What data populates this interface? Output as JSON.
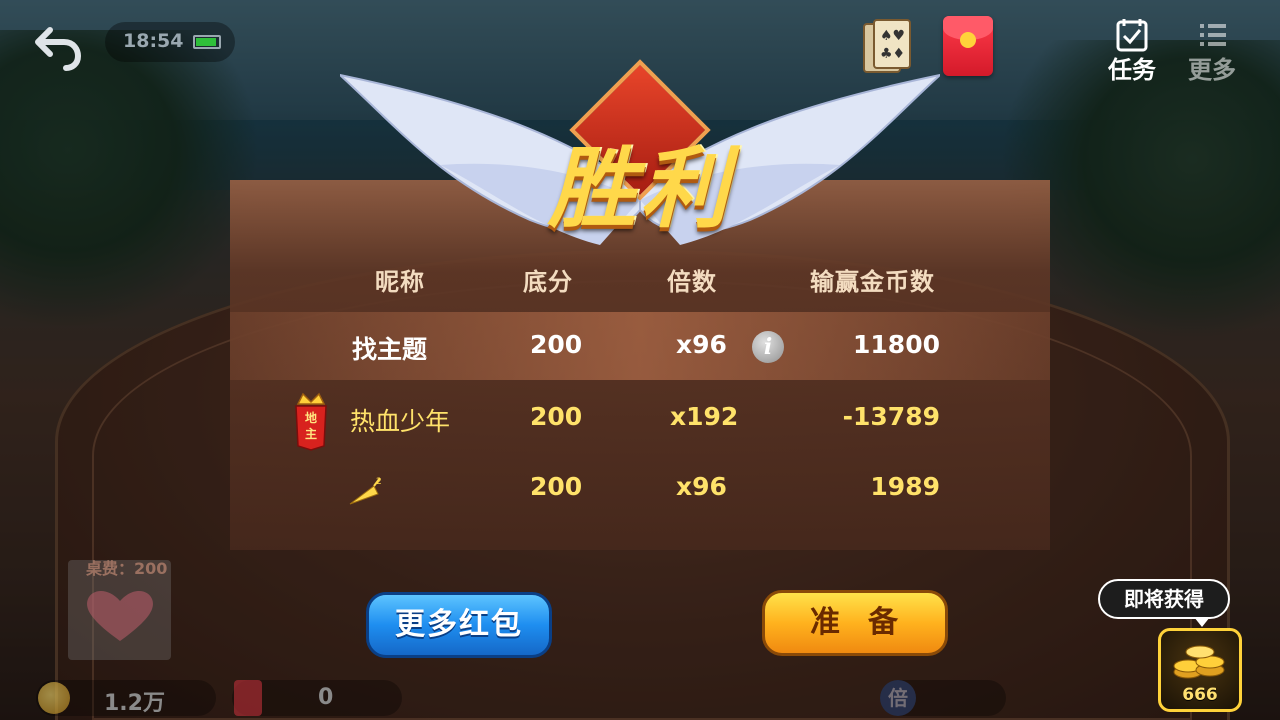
{
  "topbar": {
    "time": "18:54",
    "task_label": "任务",
    "more_label": "更多"
  },
  "result": {
    "title": "胜利",
    "headers": [
      "昵称",
      "底分",
      "倍数",
      "输赢金币数"
    ],
    "rows": [
      {
        "name": "找主题",
        "base": "200",
        "multiplier": "x96",
        "coins": "11800",
        "highlight": true
      },
      {
        "name": "热血少年",
        "base": "200",
        "multiplier": "x192",
        "coins": "-13789",
        "landlord_badge": "地主"
      },
      {
        "name": "",
        "base": "200",
        "multiplier": "x96",
        "coins": "1989"
      }
    ]
  },
  "buttons": {
    "more_redpackets": "更多红包",
    "ready": "准备"
  },
  "bottom": {
    "table_fee": "桌费：200",
    "coins": "1.2万",
    "redpackets": "0",
    "bei": "倍"
  },
  "reward": {
    "tooltip": "即将获得",
    "amount": "666"
  },
  "colors": {
    "title_gold": "#ffd84a",
    "value_yellow": "#ffe26a",
    "button_blue": "#1e8ef0",
    "button_orange": "#ffb21e"
  }
}
